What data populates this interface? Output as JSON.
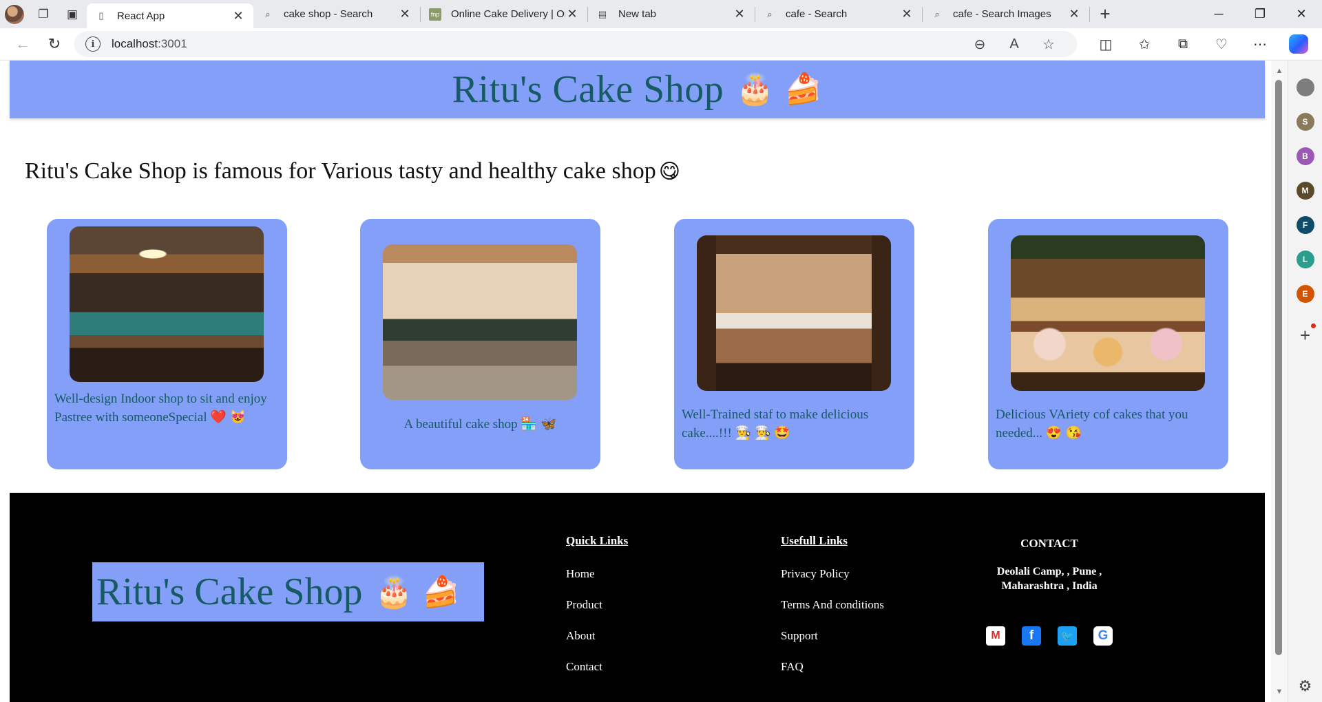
{
  "browser": {
    "tabs": [
      {
        "title": "React App",
        "icon": "page-icon",
        "active": true
      },
      {
        "title": "cake shop - Search",
        "icon": "search-icon"
      },
      {
        "title": "Online Cake Delivery | Or",
        "icon": "fnp-favicon",
        "badge": "fnp"
      },
      {
        "title": "New tab",
        "icon": "newtab-icon"
      },
      {
        "title": "cafe - Search",
        "icon": "search-icon"
      },
      {
        "title": "cafe - Search Images",
        "icon": "search-icon"
      }
    ],
    "url_host": "localhost",
    "url_port": ":3001",
    "sidebar_profiles": [
      {
        "letter": "",
        "color": "#7d7d7d"
      },
      {
        "letter": "S",
        "color": "#8a7a5c"
      },
      {
        "letter": "B",
        "color": "#9b59b6"
      },
      {
        "letter": "M",
        "color": "#5c4a2a"
      },
      {
        "letter": "F",
        "color": "#0f4c6a"
      },
      {
        "letter": "L",
        "color": "#2a9d8f"
      },
      {
        "letter": "E",
        "color": "#d35400"
      }
    ]
  },
  "header": {
    "title": "Ritu's Cake Shop",
    "emoji": "🎂 🍰"
  },
  "tagline": {
    "text": "Ritu's Cake Shop is famous for Various tasty and healthy cake shop",
    "emoji": "😋"
  },
  "cards": [
    {
      "caption": "Well-design Indoor shop to sit and enjoy Pastree with someoneSpecial ❤️ 😻"
    },
    {
      "caption": "A beautiful cake shop 🏪 🦋"
    },
    {
      "caption": "Well-Trained staf to make delicious cake....!!! 👨‍🍳 👨‍🍳 🤩"
    },
    {
      "caption": "Delicious VAriety cof cakes that you needed... 😍 😘"
    }
  ],
  "footer": {
    "brand_title": "Ritu's Cake Shop",
    "brand_emoji": "🎂 🍰",
    "quick_links": {
      "heading": "Quick Links",
      "items": [
        "Home",
        "Product",
        "About",
        "Contact"
      ]
    },
    "useful_links": {
      "heading": "Usefull Links",
      "items": [
        "Privacy Policy",
        "Terms And conditions",
        "Support",
        "FAQ"
      ]
    },
    "contact": {
      "heading": "CONTACT",
      "address": "Deolali Camp, , Pune , Maharashtra , India"
    },
    "socials": [
      {
        "name": "gmail-icon",
        "glyph": "M"
      },
      {
        "name": "facebook-icon",
        "glyph": "f"
      },
      {
        "name": "twitter-icon",
        "glyph": "🐦"
      },
      {
        "name": "google-icon",
        "glyph": "G"
      }
    ]
  },
  "colors": {
    "accent": "#839ff7",
    "title_text": "#165b63",
    "footer_bg": "#000000"
  }
}
